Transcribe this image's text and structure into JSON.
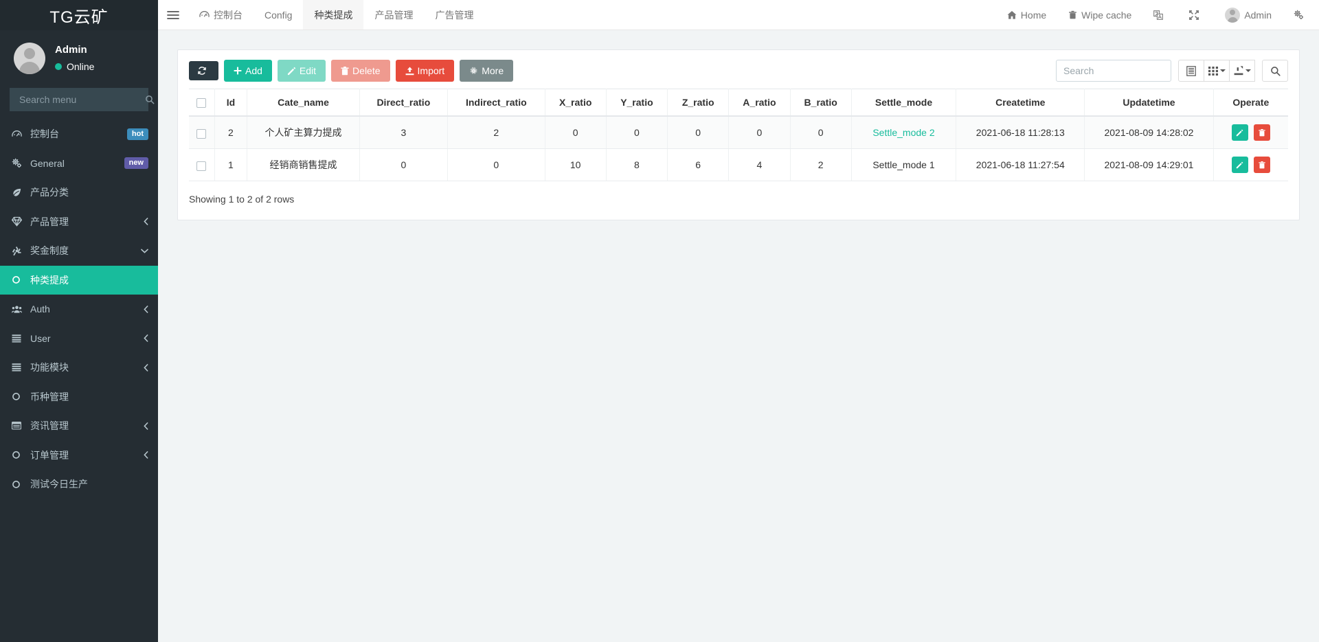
{
  "sidebar": {
    "brand": "TG云矿",
    "user": {
      "name": "Admin",
      "status": "Online",
      "avatar_icon": "user-avatar-icon"
    },
    "search": {
      "placeholder": "Search menu",
      "value": "",
      "icon": "search-icon"
    },
    "items": [
      {
        "label": "控制台",
        "icon": "dashboard-icon",
        "badge": "hot",
        "badge_color": "#3c8dbc",
        "chevron": "",
        "active": false
      },
      {
        "label": "General",
        "icon": "gears-icon",
        "badge": "new",
        "badge_color": "#605ca8",
        "chevron": "",
        "active": false
      },
      {
        "label": "产品分类",
        "icon": "leaf-icon",
        "badge": "",
        "badge_color": "",
        "chevron": "",
        "active": false
      },
      {
        "label": "产品管理",
        "icon": "diamond-icon",
        "badge": "",
        "badge_color": "",
        "chevron": "left",
        "active": false
      },
      {
        "label": "奖金制度",
        "icon": "recycle-icon",
        "badge": "",
        "badge_color": "",
        "chevron": "down",
        "active": false
      },
      {
        "label": "种类提成",
        "icon": "circle-o-icon",
        "badge": "",
        "badge_color": "",
        "chevron": "",
        "active": true
      },
      {
        "label": "Auth",
        "icon": "users-icon",
        "badge": "",
        "badge_color": "",
        "chevron": "left",
        "active": false
      },
      {
        "label": "User",
        "icon": "list-icon",
        "badge": "",
        "badge_color": "",
        "chevron": "left",
        "active": false
      },
      {
        "label": "功能模块",
        "icon": "list-icon",
        "badge": "",
        "badge_color": "",
        "chevron": "left",
        "active": false
      },
      {
        "label": "币种管理",
        "icon": "circle-o-icon",
        "badge": "",
        "badge_color": "",
        "chevron": "",
        "active": false
      },
      {
        "label": "资讯管理",
        "icon": "window-icon",
        "badge": "",
        "badge_color": "",
        "chevron": "left",
        "active": false
      },
      {
        "label": "订单管理",
        "icon": "circle-o-icon",
        "badge": "",
        "badge_color": "",
        "chevron": "left",
        "active": false
      },
      {
        "label": "测试今日生产",
        "icon": "circle-o-icon",
        "badge": "",
        "badge_color": "",
        "chevron": "",
        "active": false
      }
    ]
  },
  "topnav": {
    "hamburger_icon": "hamburger-icon",
    "tabs": [
      {
        "label": "控制台",
        "icon": "dashboard-icon",
        "active": false
      },
      {
        "label": "Config",
        "icon": "",
        "active": false
      },
      {
        "label": "种类提成",
        "icon": "",
        "active": true
      },
      {
        "label": "产品管理",
        "icon": "",
        "active": false
      },
      {
        "label": "广告管理",
        "icon": "",
        "active": false
      }
    ],
    "right": [
      {
        "label": "Home",
        "icon": "home-icon"
      },
      {
        "label": "Wipe cache",
        "icon": "trash-icon"
      },
      {
        "label": "",
        "icon": "language-icon"
      },
      {
        "label": "",
        "icon": "fullscreen-icon"
      },
      {
        "label": "Admin",
        "icon": "user-avatar-icon"
      },
      {
        "label": "",
        "icon": "gears-icon"
      }
    ]
  },
  "toolbar": {
    "refresh_label": "",
    "refresh_icon": "refresh-icon",
    "add_label": "Add",
    "edit_label": "Edit",
    "delete_label": "Delete",
    "import_label": "Import",
    "more_label": "More",
    "search_placeholder": "Search",
    "search_value": "",
    "icon_buttons": [
      "columns-toggle-icon",
      "grid-icon",
      "export-icon",
      "search-icon"
    ]
  },
  "table": {
    "columns": [
      "",
      "Id",
      "Cate_name",
      "Direct_ratio",
      "Indirect_ratio",
      "X_ratio",
      "Y_ratio",
      "Z_ratio",
      "A_ratio",
      "B_ratio",
      "Settle_mode",
      "Createtime",
      "Updatetime",
      "Operate"
    ],
    "rows": [
      {
        "id": "2",
        "cate_name": "个人矿主算力提成",
        "direct_ratio": "3",
        "indirect_ratio": "2",
        "x_ratio": "0",
        "y_ratio": "0",
        "z_ratio": "0",
        "a_ratio": "0",
        "b_ratio": "0",
        "settle_mode": "Settle_mode 2",
        "settle_mode_link": true,
        "createtime": "2021-06-18 11:28:13",
        "updatetime": "2021-08-09 14:28:02"
      },
      {
        "id": "1",
        "cate_name": "经销商销售提成",
        "direct_ratio": "0",
        "indirect_ratio": "0",
        "x_ratio": "10",
        "y_ratio": "8",
        "z_ratio": "6",
        "a_ratio": "4",
        "b_ratio": "2",
        "settle_mode": "Settle_mode 1",
        "settle_mode_link": false,
        "createtime": "2021-06-18 11:27:54",
        "updatetime": "2021-08-09 14:29:01"
      }
    ],
    "footer": "Showing 1 to 2 of 2 rows"
  },
  "colors": {
    "sidebar_bg": "#252d33",
    "accent_teal": "#18bc9c",
    "danger_red": "#e74c3c",
    "badge_hot": "#3c8dbc",
    "badge_new": "#605ca8"
  }
}
